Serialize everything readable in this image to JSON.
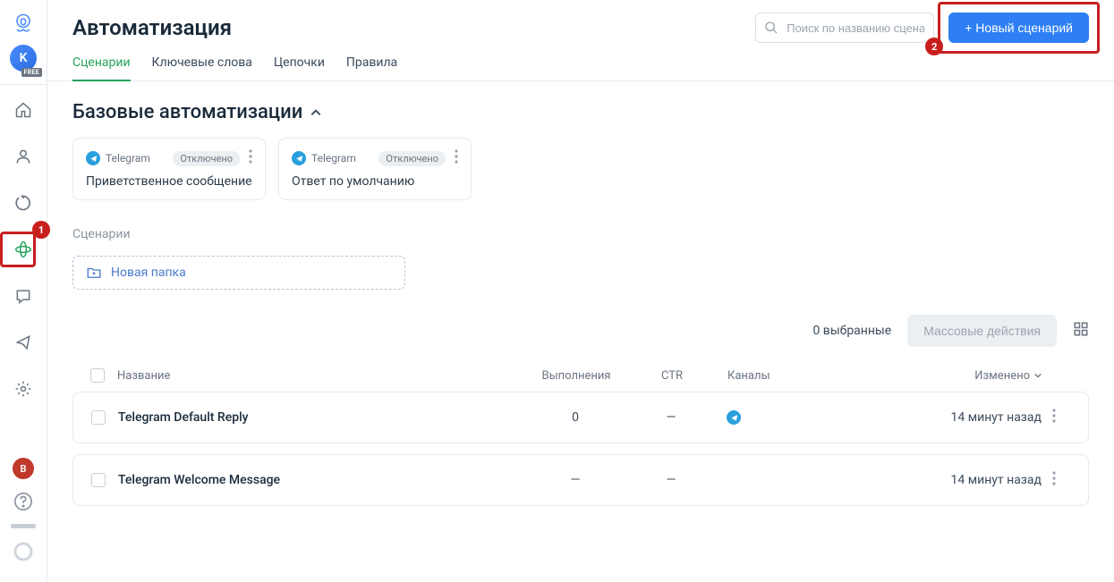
{
  "title": "Автоматизация",
  "search": {
    "placeholder": "Поиск по названию сценари"
  },
  "new_scenario_btn": "+ Новый сценарий",
  "tabs": [
    "Сценарии",
    "Ключевые слова",
    "Цепочки",
    "Правила"
  ],
  "active_tab": 0,
  "section_title": "Базовые автоматизации",
  "cards": [
    {
      "channel": "Telegram",
      "status": "Отключено",
      "title": "Приветственное сообщение"
    },
    {
      "channel": "Telegram",
      "status": "Отключено",
      "title": "Ответ по умолчанию"
    }
  ],
  "scenarios_label": "Сценарии",
  "new_folder": "Новая папка",
  "selected_text": "0 выбранные",
  "bulk_actions": "Массовые действия",
  "columns": {
    "name": "Название",
    "exec": "Выполнения",
    "ctr": "CTR",
    "channels": "Каналы",
    "modified": "Изменено"
  },
  "rows": [
    {
      "name": "Telegram Default Reply",
      "exec": "0",
      "ctr": "—",
      "channel": "telegram",
      "modified": "14 минут назад"
    },
    {
      "name": "Telegram Welcome Message",
      "exec": "—",
      "ctr": "—",
      "channel": "",
      "modified": "14 минут назад"
    }
  ],
  "avatar": {
    "letter": "K",
    "badge": "FREE"
  },
  "user_letter": "В",
  "annotations": {
    "1": "1",
    "2": "2"
  }
}
